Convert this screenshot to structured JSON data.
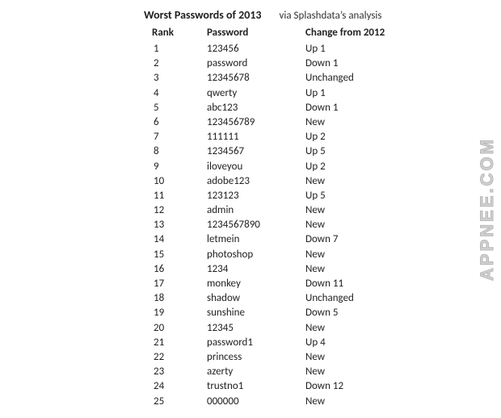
{
  "header": {
    "title": "Worst Passwords of 2013",
    "subtitle": "via Splashdata’s analysis"
  },
  "columns": {
    "rank": "Rank",
    "password": "Password",
    "change": "Change from 2012"
  },
  "rows": [
    {
      "rank": "1",
      "password": "123456",
      "change": "Up 1"
    },
    {
      "rank": "2",
      "password": "password",
      "change": "Down 1"
    },
    {
      "rank": "3",
      "password": "12345678",
      "change": "Unchanged"
    },
    {
      "rank": "4",
      "password": "qwerty",
      "change": "Up 1"
    },
    {
      "rank": "5",
      "password": "abc123",
      "change": "Down 1"
    },
    {
      "rank": "6",
      "password": "123456789",
      "change": "New"
    },
    {
      "rank": "7",
      "password": "111111",
      "change": "Up 2"
    },
    {
      "rank": "8",
      "password": "1234567",
      "change": "Up 5"
    },
    {
      "rank": "9",
      "password": "iloveyou",
      "change": "Up 2"
    },
    {
      "rank": "10",
      "password": "adobe123",
      "change": "New"
    },
    {
      "rank": "11",
      "password": "123123",
      "change": "Up 5"
    },
    {
      "rank": "12",
      "password": "admin",
      "change": "New"
    },
    {
      "rank": "13",
      "password": "1234567890",
      "change": "New"
    },
    {
      "rank": "14",
      "password": "letmein",
      "change": "Down 7"
    },
    {
      "rank": "15",
      "password": "photoshop",
      "change": "New"
    },
    {
      "rank": "16",
      "password": "1234",
      "change": "New"
    },
    {
      "rank": "17",
      "password": "monkey",
      "change": "Down 11"
    },
    {
      "rank": "18",
      "password": "shadow",
      "change": "Unchanged"
    },
    {
      "rank": "19",
      "password": "sunshine",
      "change": "Down 5"
    },
    {
      "rank": "20",
      "password": "12345",
      "change": "New"
    },
    {
      "rank": "21",
      "password": "password1",
      "change": "Up 4"
    },
    {
      "rank": "22",
      "password": "princess",
      "change": "New"
    },
    {
      "rank": "23",
      "password": "azerty",
      "change": "New"
    },
    {
      "rank": "24",
      "password": "trustno1",
      "change": "Down 12"
    },
    {
      "rank": "25",
      "password": "000000",
      "change": "New"
    }
  ],
  "watermark": "APPNEE.COM",
  "chart_data": {
    "type": "table",
    "title": "Worst Passwords of 2013",
    "columns": [
      "Rank",
      "Password",
      "Change from 2012"
    ],
    "rows": [
      [
        1,
        "123456",
        "Up 1"
      ],
      [
        2,
        "password",
        "Down 1"
      ],
      [
        3,
        "12345678",
        "Unchanged"
      ],
      [
        4,
        "qwerty",
        "Up 1"
      ],
      [
        5,
        "abc123",
        "Down 1"
      ],
      [
        6,
        "123456789",
        "New"
      ],
      [
        7,
        "111111",
        "Up 2"
      ],
      [
        8,
        "1234567",
        "Up 5"
      ],
      [
        9,
        "iloveyou",
        "Up 2"
      ],
      [
        10,
        "adobe123",
        "New"
      ],
      [
        11,
        "123123",
        "Up 5"
      ],
      [
        12,
        "admin",
        "New"
      ],
      [
        13,
        "1234567890",
        "New"
      ],
      [
        14,
        "letmein",
        "Down 7"
      ],
      [
        15,
        "photoshop",
        "New"
      ],
      [
        16,
        "1234",
        "New"
      ],
      [
        17,
        "monkey",
        "Down 11"
      ],
      [
        18,
        "shadow",
        "Unchanged"
      ],
      [
        19,
        "sunshine",
        "Down 5"
      ],
      [
        20,
        "12345",
        "New"
      ],
      [
        21,
        "password1",
        "Up 4"
      ],
      [
        22,
        "princess",
        "New"
      ],
      [
        23,
        "azerty",
        "New"
      ],
      [
        24,
        "trustno1",
        "Down 12"
      ],
      [
        25,
        "000000",
        "New"
      ]
    ]
  }
}
